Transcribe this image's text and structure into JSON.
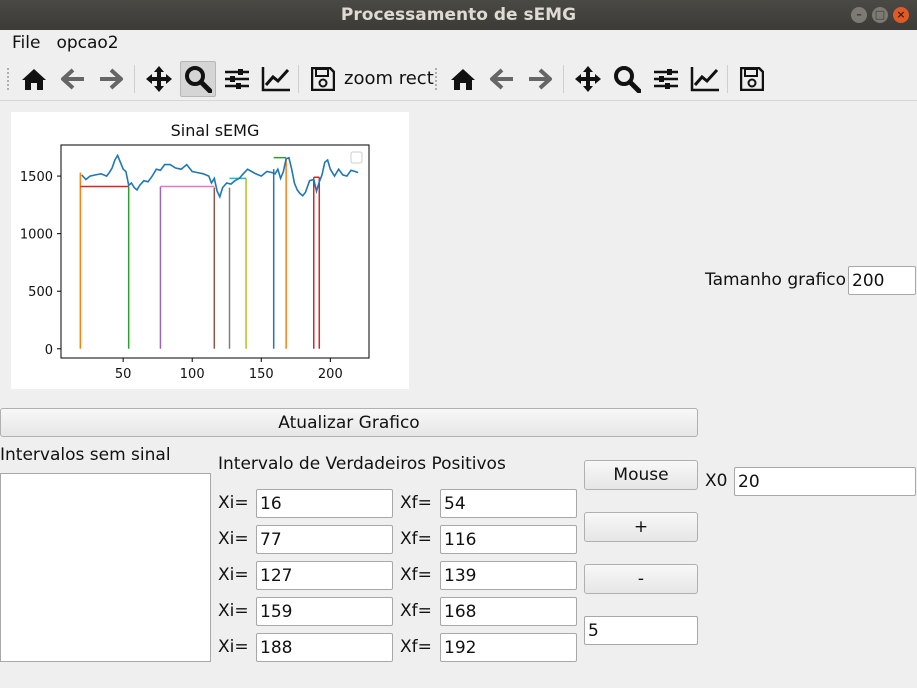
{
  "window": {
    "title": "Processamento de sEMG"
  },
  "menu": {
    "file": "File",
    "opcao2": "opcao2"
  },
  "toolbar": {
    "left": [
      "home-icon",
      "back-arrow-icon",
      "forward-arrow-icon",
      "pan-icon",
      "zoom-icon",
      "configure-subplots-icon",
      "edit-curves-icon",
      "save-icon"
    ],
    "mode_text": "zoom rect",
    "right": [
      "home-icon",
      "back-arrow-icon",
      "forward-arrow-icon",
      "pan-icon",
      "zoom-icon",
      "configure-subplots-icon",
      "edit-curves-icon",
      "save-icon"
    ]
  },
  "controls": {
    "update_button": "Atualizar Grafico",
    "silent_intervals_label": "Intervalos sem sinal",
    "true_positive_label": "Intervalo de Verdadeiros Positivos",
    "xi_label": "Xi=",
    "xf_label": "Xf=",
    "intervals": [
      {
        "xi": "16",
        "xf": "54"
      },
      {
        "xi": "77",
        "xf": "116"
      },
      {
        "xi": "127",
        "xf": "139"
      },
      {
        "xi": "159",
        "xf": "168"
      },
      {
        "xi": "188",
        "xf": "192"
      }
    ],
    "mouse_button": "Mouse",
    "plus_button": "+",
    "minus_button": "-",
    "step_value": "5",
    "size_label": "Tamanho grafico",
    "size_value": "200",
    "x0_label": "X0",
    "x0_value": "20"
  },
  "chart_data": {
    "type": "line",
    "title": "Sinal sEMG",
    "xlabel": "",
    "ylabel": "",
    "xlim": [
      5,
      228
    ],
    "ylim": [
      -80,
      1770
    ],
    "xticks": [
      50,
      100,
      150,
      200
    ],
    "yticks": [
      0,
      500,
      1000,
      1500
    ],
    "legend": "top-right (empty box)",
    "signal": {
      "color": "#1f77b4",
      "x": [
        20,
        23,
        26,
        30,
        34,
        38,
        40,
        42,
        44,
        46,
        48,
        50,
        52,
        54,
        56,
        58,
        60,
        62,
        65,
        68,
        71,
        74,
        77,
        80,
        84,
        88,
        92,
        96,
        100,
        104,
        108,
        112,
        114,
        116,
        118,
        120,
        122,
        125,
        128,
        131,
        134,
        137,
        140,
        143,
        146,
        150,
        154,
        158,
        160,
        162,
        164,
        166,
        168,
        170,
        172,
        174,
        176,
        178,
        180,
        182,
        185,
        188,
        190,
        192,
        194,
        196,
        198,
        200,
        203,
        206,
        209,
        212,
        215,
        218,
        220
      ],
      "y": [
        1510,
        1470,
        1500,
        1510,
        1520,
        1500,
        1530,
        1570,
        1640,
        1680,
        1620,
        1560,
        1540,
        1420,
        1440,
        1400,
        1380,
        1420,
        1460,
        1450,
        1500,
        1560,
        1550,
        1600,
        1600,
        1570,
        1560,
        1600,
        1540,
        1530,
        1520,
        1500,
        1440,
        1480,
        1370,
        1320,
        1400,
        1440,
        1430,
        1460,
        1480,
        1520,
        1560,
        1540,
        1520,
        1500,
        1540,
        1530,
        1520,
        1560,
        1480,
        1540,
        1650,
        1660,
        1560,
        1440,
        1380,
        1350,
        1330,
        1360,
        1460,
        1470,
        1370,
        1450,
        1510,
        1620,
        1640,
        1560,
        1500,
        1560,
        1510,
        1500,
        1550,
        1540,
        1530
      ]
    },
    "vertical_lines": [
      {
        "x": 19,
        "y": [
          0,
          1530
        ],
        "color": "#ff7f0e"
      },
      {
        "x": 54,
        "y": [
          0,
          1410
        ],
        "color": "#2ca02c"
      },
      {
        "x": 77,
        "y": [
          0,
          1410
        ],
        "color": "#9467bd"
      },
      {
        "x": 116,
        "y": [
          0,
          1400
        ],
        "color": "#8c564b"
      },
      {
        "x": 127,
        "y": [
          0,
          1400
        ],
        "color": "#7f7f7f"
      },
      {
        "x": 139,
        "y": [
          0,
          1480
        ],
        "color": "#bcbd22"
      },
      {
        "x": 159,
        "y": [
          0,
          1560
        ],
        "color": "#1f77b4"
      },
      {
        "x": 168,
        "y": [
          0,
          1650
        ],
        "color": "#ff7f0e"
      },
      {
        "x": 188,
        "y": [
          0,
          1490
        ],
        "color": "#d62728"
      },
      {
        "x": 192,
        "y": [
          0,
          1490
        ],
        "color": "#d62728"
      }
    ],
    "horizontal_lines": [
      {
        "x": [
          19,
          54
        ],
        "y": 1410,
        "color": "#d62728"
      },
      {
        "x": [
          77,
          116
        ],
        "y": 1410,
        "color": "#e377c2"
      },
      {
        "x": [
          127,
          139
        ],
        "y": 1480,
        "color": "#17becf"
      },
      {
        "x": [
          159,
          168
        ],
        "y": 1660,
        "color": "#2ca02c"
      },
      {
        "x": [
          188,
          192
        ],
        "y": 1490,
        "color": "#d62728"
      }
    ]
  }
}
